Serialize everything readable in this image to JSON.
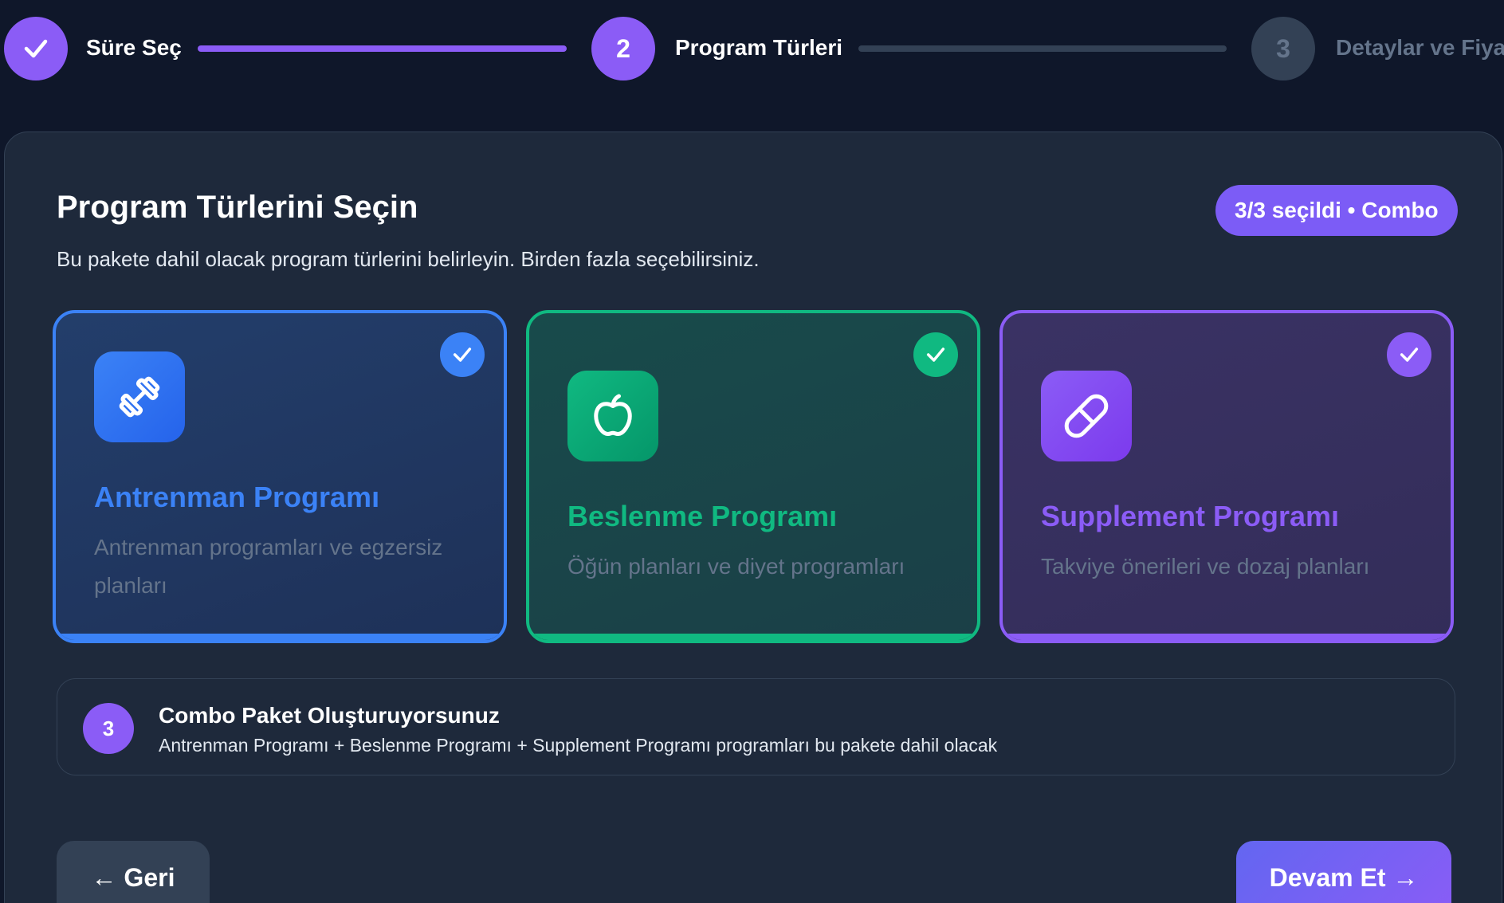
{
  "stepper": {
    "steps": [
      {
        "number": "",
        "label": "Süre Seç",
        "state": "done"
      },
      {
        "number": "2",
        "label": "Program Türleri",
        "state": "active"
      },
      {
        "number": "3",
        "label": "Detaylar ve Fiyat",
        "state": "pending"
      }
    ]
  },
  "panel": {
    "title": "Program Türlerini Seçin",
    "subtitle": "Bu pakete dahil olacak program türlerini belirleyin. Birden fazla seçebilirsiniz.",
    "badge": "3/3 seçildi • Combo"
  },
  "cards": [
    {
      "title": "Antrenman Programı",
      "desc": "Antrenman programları ve egzersiz planları",
      "icon": "dumbbell-icon",
      "color": "#3b82f6",
      "selected": true
    },
    {
      "title": "Beslenme Programı",
      "desc": "Öğün planları ve diyet programları",
      "icon": "apple-icon",
      "color": "#10b981",
      "selected": true
    },
    {
      "title": "Supplement Programı",
      "desc": "Takviye önerileri ve dozaj planları",
      "icon": "pill-icon",
      "color": "#8b5cf6",
      "selected": true
    }
  ],
  "combo": {
    "count": "3",
    "title": "Combo Paket Oluşturuyorsunuz",
    "text": "Antrenman Programı + Beslenme Programı + Supplement Programı programları bu pakete dahil olacak"
  },
  "buttons": {
    "back": "← Geri",
    "next": "Devam Et →"
  },
  "colors": {
    "accent": "#8b5cf6",
    "background": "#0f172a",
    "panel": "#1e293b"
  }
}
